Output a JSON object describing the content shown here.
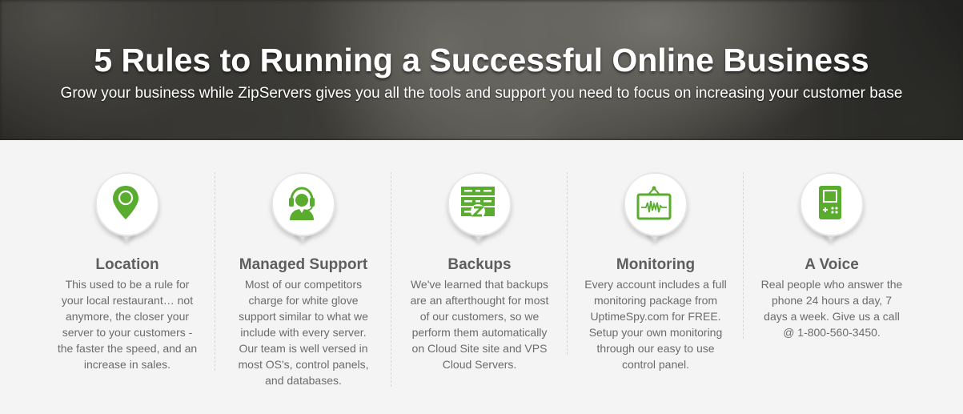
{
  "hero": {
    "title": "5 Rules to Running a Successful Online Business",
    "subtitle": "Grow your business while ZipServers gives you all the tools and support you need to focus on increasing your customer base"
  },
  "colors": {
    "accent": "#5aac2f",
    "title_text": "#5e5e5e",
    "body_text": "#6b6b6b"
  },
  "features": [
    {
      "icon": "location-pin-icon",
      "title": "Location",
      "text": "This used to be a rule for your local restaurant… not anymore, the closer your server to your customers - the faster the speed, and an increase in sales."
    },
    {
      "icon": "headset-support-icon",
      "title": "Managed Support",
      "text": "Most of our competitors charge for white glove support similar to what we include with every server. Our team is well versed in most OS's, control panels, and databases."
    },
    {
      "icon": "server-backup-icon",
      "title": "Backups",
      "text": "We've learned that backups are an afterthought for most of our customers, so we perform them automatically on Cloud Site site and VPS Cloud Servers."
    },
    {
      "icon": "monitor-heartbeat-icon",
      "title": "Monitoring",
      "text": "Every account includes a full monitoring package from UptimeSpy.com for FREE. Setup your own monitoring through our easy to use control panel."
    },
    {
      "icon": "phone-device-icon",
      "title": "A Voice",
      "text": "Real people who answer the phone 24 hours a day, 7 days a week. Give us a call @ 1-800-560-3450."
    }
  ]
}
